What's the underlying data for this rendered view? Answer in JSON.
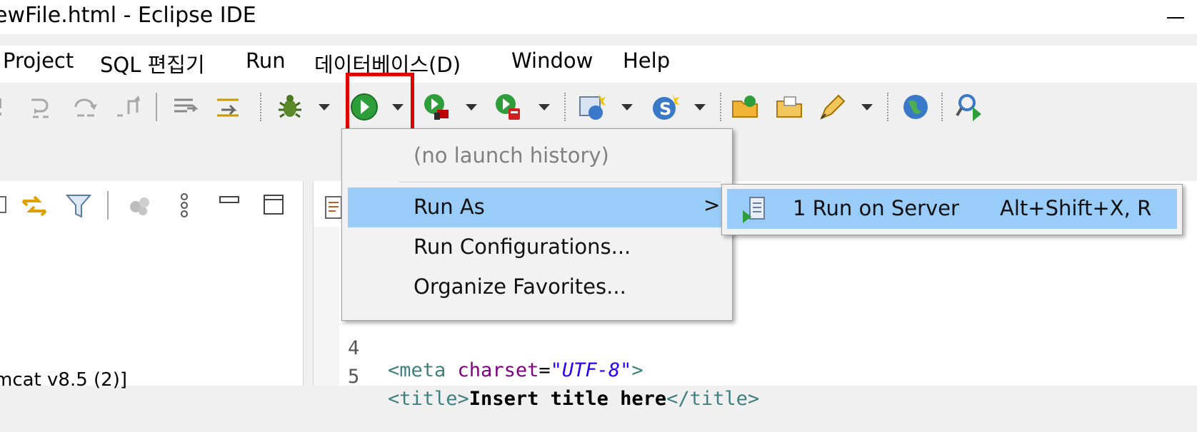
{
  "window": {
    "title": "ewFile.html - Eclipse IDE"
  },
  "menubar": {
    "items": [
      "Project",
      "SQL 편집기",
      "Run",
      "데이터베이스(D)",
      "Window",
      "Help"
    ]
  },
  "run_menu": {
    "history_label": "(no launch history)",
    "items": [
      "Run As",
      "Run Configurations...",
      "Organize Favorites..."
    ],
    "submenu_chevron": ">"
  },
  "run_as_submenu": {
    "item_label": "1 Run on Server",
    "accelerator": "Alt+Shift+X, R"
  },
  "editor": {
    "lines": [
      {
        "num": "4",
        "open": "<meta ",
        "attr": "charset",
        "eq": "=",
        "value": "\"UTF-8\"",
        "close": ">"
      },
      {
        "num": "5",
        "open": "<title>",
        "text": "Insert title here",
        "close": "</title>"
      }
    ]
  },
  "project_explorer": {
    "partial_item": "mcat v8.5 (2)]"
  },
  "colors": {
    "menu_highlight": "#99ccf8",
    "annotation_box": "#e00000",
    "run_green": "#2e9e3a"
  },
  "icons": [
    "step-into-icon",
    "step-over-icon",
    "step-return-icon",
    "drop-frame-icon",
    "use-step-filters-icon",
    "skip-breakpoints-icon",
    "debug-bug-icon",
    "run-icon",
    "coverage-icon",
    "external-tools-icon",
    "new-server-icon",
    "new-java-class-icon",
    "open-project-icon",
    "open-folder-icon",
    "pen-icon",
    "web-browser-globe-icon",
    "search-icon",
    "collapse-all-icon",
    "link-with-editor-icon",
    "filter-icon",
    "view-menu-icon",
    "minimize-icon",
    "maximize-icon",
    "server-run-icon",
    "html-file-icon"
  ]
}
